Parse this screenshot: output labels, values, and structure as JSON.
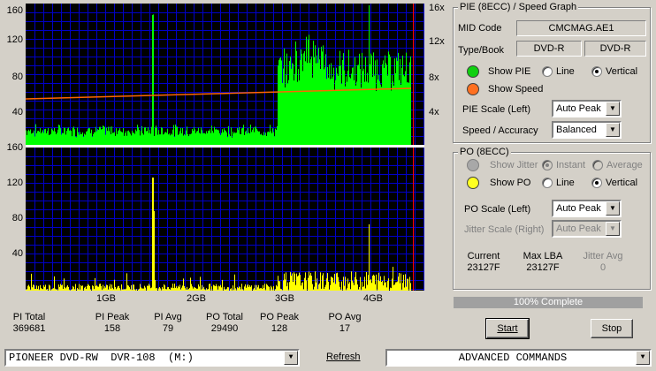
{
  "graphs": {
    "pie_axis_left": [
      "160",
      "120",
      "80",
      "40"
    ],
    "pie_axis_right": [
      "16x",
      "12x",
      "8x",
      "4x"
    ],
    "po_axis_left": [
      "160",
      "120",
      "80",
      "40"
    ],
    "x_ticks": [
      "1GB",
      "2GB",
      "3GB",
      "4GB"
    ],
    "colors": {
      "background": "#000000",
      "grid": "#0000c8",
      "pie": "#00ff00",
      "po": "#ffff00",
      "speed": "#ff6600",
      "end_marker": "#ff0000"
    }
  },
  "stats": [
    {
      "label": "PI Total",
      "value": "369681"
    },
    {
      "label": "PI Peak",
      "value": "158"
    },
    {
      "label": "PI Avg",
      "value": "79"
    },
    {
      "label": "PO Total",
      "value": "29490"
    },
    {
      "label": "PO Peak",
      "value": "128"
    },
    {
      "label": "PO Avg",
      "value": "17"
    }
  ],
  "pie_group": {
    "title": "PIE (8ECC) / Speed Graph",
    "mid_code_label": "MID Code",
    "mid_code_value": "CMCMAG.AE1",
    "type_book_label": "Type/Book",
    "type_value": "DVD-R",
    "book_value": "DVD-R",
    "show_pie_label": "Show PIE",
    "line_label": "Line",
    "vertical_label": "Vertical",
    "show_speed_label": "Show Speed",
    "pie_scale_label": "PIE Scale (Left)",
    "pie_scale_value": "Auto Peak",
    "speed_accuracy_label": "Speed / Accuracy",
    "speed_accuracy_value": "Balanced"
  },
  "po_group": {
    "title": "PO (8ECC)",
    "show_jitter_label": "Show Jitter",
    "instant_label": "Instant",
    "average_label": "Average",
    "show_po_label": "Show PO",
    "line_label": "Line",
    "vertical_label": "Vertical",
    "po_scale_label": "PO Scale (Left)",
    "po_scale_value": "Auto Peak",
    "jitter_scale_label": "Jitter Scale (Right)",
    "jitter_scale_value": "Auto Peak",
    "current_label": "Current",
    "current_value": "23127F",
    "max_lba_label": "Max LBA",
    "max_lba_value": "23127F",
    "jitter_avg_label": "Jitter Avg",
    "jitter_avg_value": "0"
  },
  "progress": {
    "text": "100% Complete",
    "percent": 100
  },
  "buttons": {
    "start": "Start",
    "stop": "Stop"
  },
  "bottom": {
    "drive_value": "PIONEER DVD-RW  DVR-108  (M:)",
    "refresh_label": "Refresh",
    "commands_value": "ADVANCED COMMANDS"
  }
}
